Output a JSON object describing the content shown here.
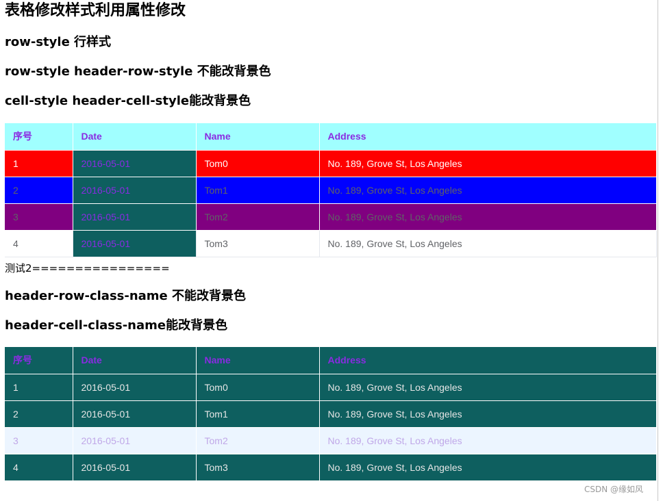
{
  "headings": {
    "main": "表格修改样式利用属性修改",
    "h1": "row-style 行样式",
    "h2": "row-style header-row-style 不能改背景色",
    "h3": "cell-style header-cell-style能改背景色",
    "divider": "测试2================",
    "h4": "header-row-class-name 不能改背景色",
    "h5": "header-cell-class-name能改背景色"
  },
  "table1": {
    "columns": [
      "序号",
      "Date",
      "Name",
      "Address"
    ],
    "rows": [
      {
        "idx": "1",
        "date": "2016-05-01",
        "name": "Tom0",
        "address": "No. 189, Grove St, Los Angeles"
      },
      {
        "idx": "2",
        "date": "2016-05-01",
        "name": "Tom1",
        "address": "No. 189, Grove St, Los Angeles"
      },
      {
        "idx": "3",
        "date": "2016-05-01",
        "name": "Tom2",
        "address": "No. 189, Grove St, Los Angeles"
      },
      {
        "idx": "4",
        "date": "2016-05-01",
        "name": "Tom3",
        "address": "No. 189, Grove St, Los Angeles"
      }
    ]
  },
  "table2": {
    "columns": [
      "序号",
      "Date",
      "Name",
      "Address"
    ],
    "rows": [
      {
        "idx": "1",
        "date": "2016-05-01",
        "name": "Tom0",
        "address": "No. 189, Grove St, Los Angeles"
      },
      {
        "idx": "2",
        "date": "2016-05-01",
        "name": "Tom1",
        "address": "No. 189, Grove St, Los Angeles"
      },
      {
        "idx": "3",
        "date": "2016-05-01",
        "name": "Tom2",
        "address": "No. 189, Grove St, Los Angeles"
      },
      {
        "idx": "4",
        "date": "2016-05-01",
        "name": "Tom3",
        "address": "No. 189, Grove St, Los Angeles"
      }
    ]
  },
  "colors": {
    "header_text": "#8a2be2",
    "table1_header_bg": "#a0ffff",
    "row_red": "#ff0000",
    "row_blue": "#0000ff",
    "row_purple": "#800080",
    "teal": "#0e5f5f",
    "highlight_row": "#ecf5ff"
  },
  "watermark": "CSDN @缘如风"
}
